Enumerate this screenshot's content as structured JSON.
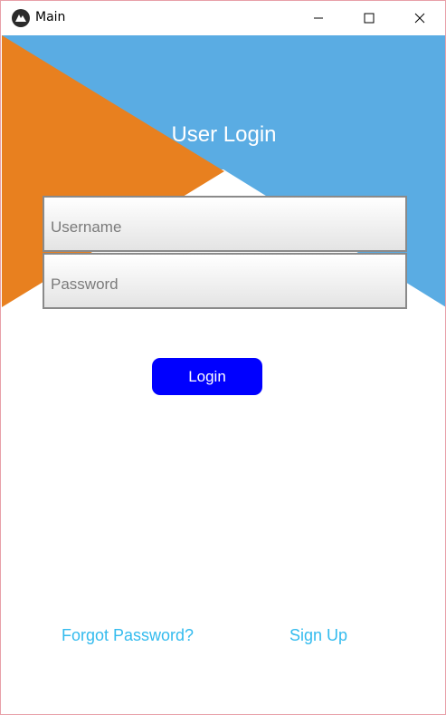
{
  "window": {
    "title": "Main",
    "icon": "kivy-app-icon",
    "controls": [
      "minimize-icon",
      "maximize-icon",
      "close-icon"
    ]
  },
  "login": {
    "title": "User Login",
    "username_placeholder": "Username",
    "password_placeholder": "Password",
    "username_value": "",
    "password_value": "",
    "login_label": "Login"
  },
  "links": {
    "forgot_password": "Forgot Password?",
    "sign_up": "Sign Up"
  },
  "colors": {
    "background_blue": "#5aace3",
    "background_orange": "#e8801f",
    "button_blue": "#0000ff",
    "link_color": "#33bbee"
  }
}
